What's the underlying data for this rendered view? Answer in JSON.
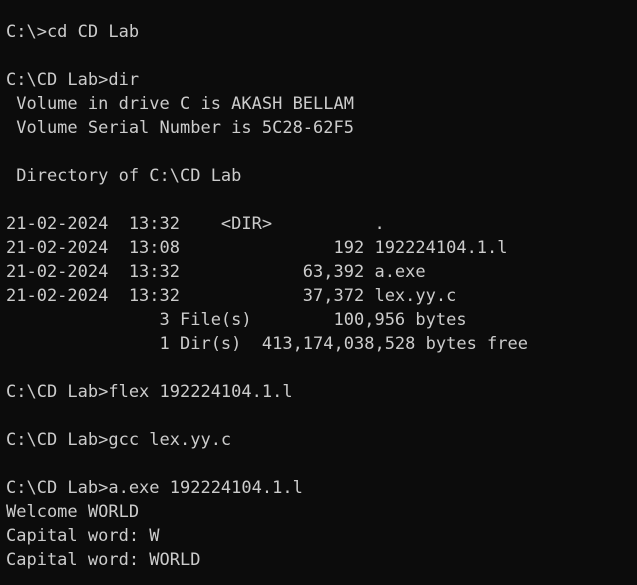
{
  "console": {
    "lines": [
      "C:\\>cd CD Lab",
      "",
      "C:\\CD Lab>dir",
      " Volume in drive C is AKASH BELLAM",
      " Volume Serial Number is 5C28-62F5",
      "",
      " Directory of C:\\CD Lab",
      "",
      "21-02-2024  13:32    <DIR>          .",
      "21-02-2024  13:08               192 192224104.1.l",
      "21-02-2024  13:32            63,392 a.exe",
      "21-02-2024  13:32            37,372 lex.yy.c",
      "               3 File(s)        100,956 bytes",
      "               1 Dir(s)  413,174,038,528 bytes free",
      "",
      "C:\\CD Lab>flex 192224104.1.l",
      "",
      "C:\\CD Lab>gcc lex.yy.c",
      "",
      "C:\\CD Lab>a.exe 192224104.1.l",
      "Welcome WORLD",
      "Capital word: W",
      "Capital word: WORLD"
    ]
  }
}
